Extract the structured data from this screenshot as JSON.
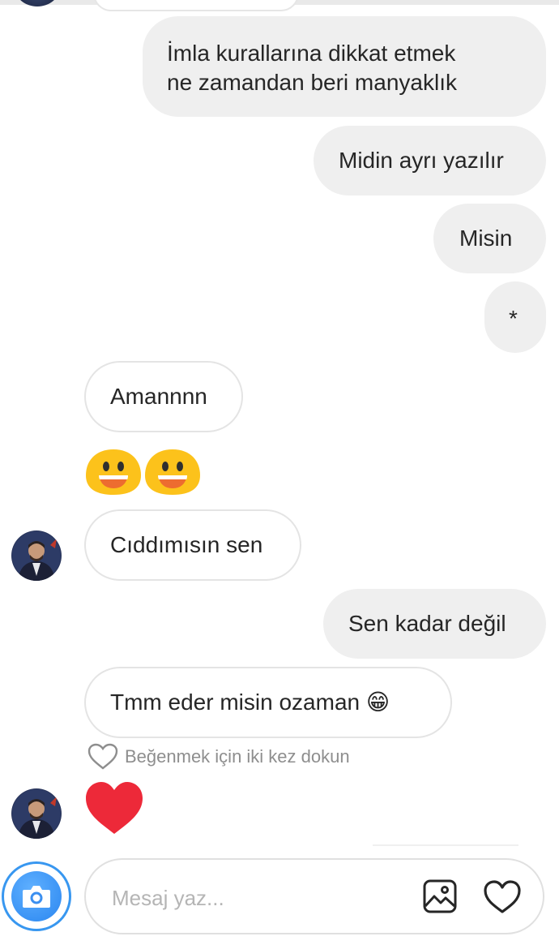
{
  "messages": [
    {
      "sender": "me",
      "text": "İmla kurallarına dikkat etmek\nne zamandan beri manyaklık"
    },
    {
      "sender": "me",
      "text": "Midin ayrı yazılır"
    },
    {
      "sender": "me",
      "text": "Misin"
    },
    {
      "sender": "me",
      "text": "*"
    },
    {
      "sender": "them",
      "text": "Amannnn"
    },
    {
      "sender": "them",
      "text": "😀😀",
      "type": "emoji"
    },
    {
      "sender": "them",
      "text": "Cıddımısın sen"
    },
    {
      "sender": "me",
      "text": "Sen kadar değil"
    },
    {
      "sender": "them",
      "text": "Tmm eder misin ozaman 😁"
    },
    {
      "sender": "them",
      "type": "like",
      "icon": "heart-icon"
    }
  ],
  "like_hint": "Beğenmek için iki kez dokun",
  "composer": {
    "placeholder": "Mesaj yaz..."
  },
  "icons": {
    "camera": "camera-icon",
    "gallery": "image-icon",
    "heart": "heart-icon"
  },
  "colors": {
    "outgoing_bubble": "#efefef",
    "incoming_border": "#e4e4e4",
    "emoji_yellow": "#fcc21b",
    "heart_red": "#ed2939",
    "camera_blue": "#3897f0"
  }
}
